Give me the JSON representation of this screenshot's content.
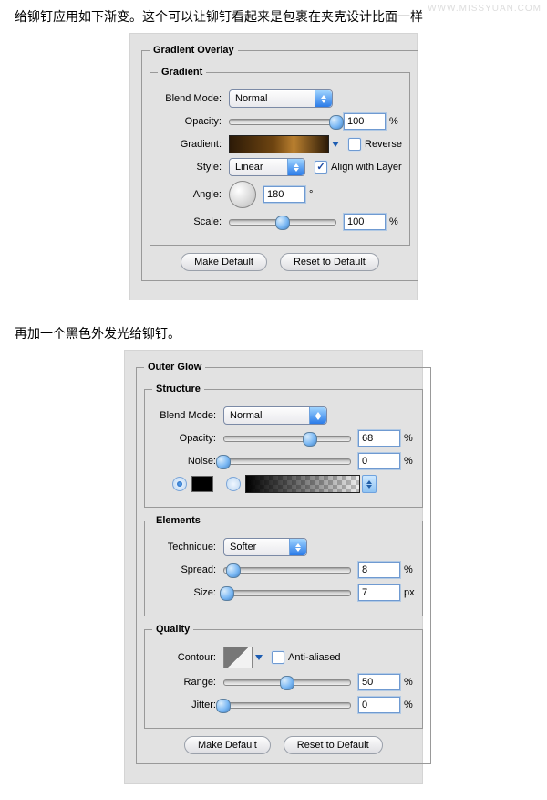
{
  "watermark": "WWW.MISSYUAN.COM",
  "text1": "给铆钉应用如下渐变。这个可以让铆钉看起来是包裹在夹克设计比面一样",
  "text2": "再加一个黑色外发光给铆钉。",
  "go": {
    "title": "Gradient Overlay",
    "gradientSection": "Gradient",
    "blendModeLabel": "Blend Mode:",
    "blendMode": "Normal",
    "opacityLabel": "Opacity:",
    "opacity": "100",
    "gradientLabel": "Gradient:",
    "reverse": "Reverse",
    "styleLabel": "Style:",
    "style": "Linear",
    "align": "Align with Layer",
    "angleLabel": "Angle:",
    "angle": "180",
    "scaleLabel": "Scale:",
    "scale": "100",
    "makeDefault": "Make Default",
    "resetDefault": "Reset to Default"
  },
  "og": {
    "title": "Outer Glow",
    "structure": "Structure",
    "blendModeLabel": "Blend Mode:",
    "blendMode": "Normal",
    "opacityLabel": "Opacity:",
    "opacity": "68",
    "noiseLabel": "Noise:",
    "noise": "0",
    "elements": "Elements",
    "techniqueLabel": "Technique:",
    "technique": "Softer",
    "spreadLabel": "Spread:",
    "spread": "8",
    "sizeLabel": "Size:",
    "size": "7",
    "quality": "Quality",
    "contourLabel": "Contour:",
    "anti": "Anti-aliased",
    "rangeLabel": "Range:",
    "range": "50",
    "jitterLabel": "Jitter:",
    "jitter": "0",
    "makeDefault": "Make Default",
    "resetDefault": "Reset to Default",
    "pct": "%",
    "px": "px",
    "deg": "°"
  }
}
